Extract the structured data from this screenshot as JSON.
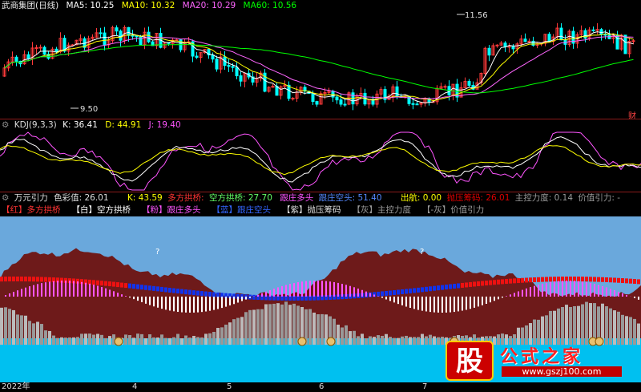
{
  "main_header": {
    "title": "武商集团(日线)",
    "ma5": "MA5: 10.25",
    "ma10": "MA10: 10.32",
    "ma20": "MA20: 10.29",
    "ma60": "MA60: 10.56",
    "color_title": "#e8e8e8",
    "color_ma5": "#ffffff",
    "color_ma10": "#ffff00",
    "color_ma20": "#ff66ff",
    "color_ma60": "#00ff00"
  },
  "main_labels": {
    "high": "11.56",
    "low": "9.50",
    "fin": "财"
  },
  "kdj_header": {
    "name": "KDJ(9,3,3)",
    "k": "K: 36.41",
    "d": "D: 44.91",
    "j": "J: 19.40"
  },
  "ind_header": {
    "name": "万元引力",
    "color_value": "色彩值: 26.01",
    "k": "K: 43.59",
    "dfgq": "多方拱桥:",
    "kfgq": "空方拱桥: 27.70",
    "gzdt": "跟庄多头",
    "gzkt": "跟庄空头: 51.40",
    "ch": "出航: 0.00",
    "dyzm": "抛压筹码: 26.01",
    "zklb": "主控力度: 0.14",
    "jzyl": "价值引力: -"
  },
  "legend": [
    {
      "text": "【红】多方拱桥",
      "color": "#ff3333"
    },
    {
      "text": "【白】空方拱桥",
      "color": "#ffffff"
    },
    {
      "text": "【粉】跟庄多头",
      "color": "#ff55ff"
    },
    {
      "text": "【蓝】跟庄空头",
      "color": "#3366ff"
    },
    {
      "text": "【紫】抛压筹码",
      "color": "#dddddd"
    },
    {
      "text": "【灰】主控力度",
      "color": "#999999"
    },
    {
      "text": "【-灰】价值引力",
      "color": "#999999"
    }
  ],
  "question_marks": [
    "?",
    "?"
  ],
  "x_axis": [
    "2022年",
    "4",
    "5",
    "6",
    "7"
  ],
  "watermark": {
    "logo": "股",
    "name": "公式之家",
    "url": "www.gszj100.com"
  }
}
